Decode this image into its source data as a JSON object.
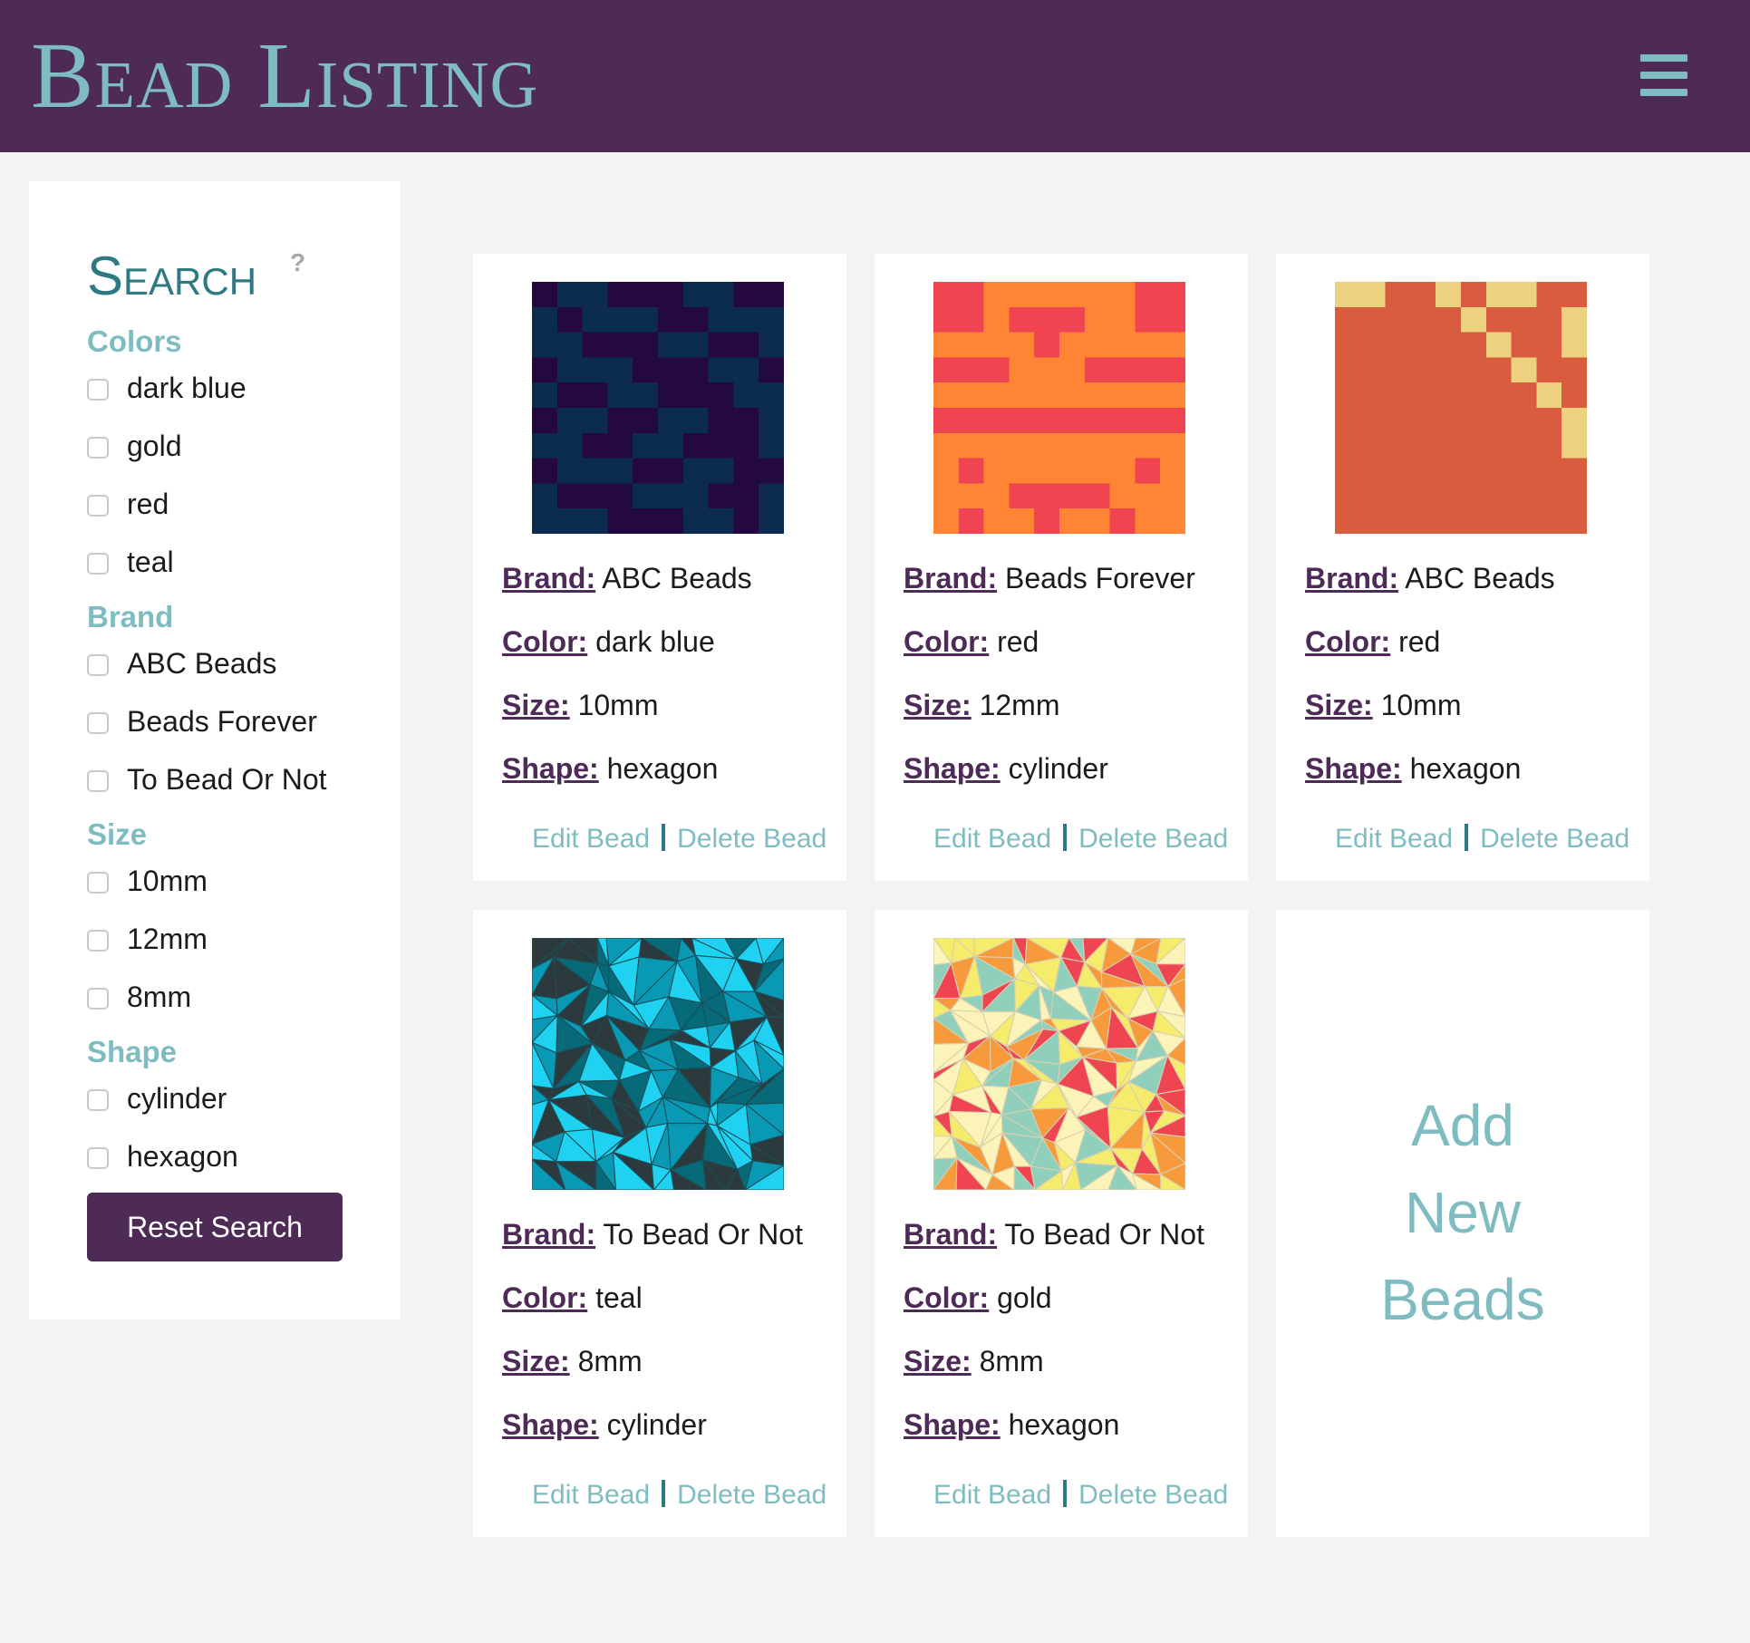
{
  "header": {
    "title": "Bead Listing",
    "menu_icon": "hamburger-menu-icon"
  },
  "search": {
    "title": "Search",
    "help": "?",
    "groups": [
      {
        "title": "Colors",
        "options": [
          "dark blue",
          "gold",
          "red",
          "teal"
        ]
      },
      {
        "title": "Brand",
        "options": [
          "ABC Beads",
          "Beads Forever",
          "To Bead Or Not"
        ]
      },
      {
        "title": "Size",
        "options": [
          "10mm",
          "12mm",
          "8mm"
        ]
      },
      {
        "title": "Shape",
        "options": [
          "cylinder",
          "hexagon"
        ]
      }
    ],
    "reset_label": "Reset Search"
  },
  "labels": {
    "brand": "Brand:",
    "color": "Color:",
    "size": "Size:",
    "shape": "Shape:",
    "edit": "Edit Bead",
    "delete": "Delete Bead"
  },
  "beads": [
    {
      "brand": "ABC Beads",
      "color": "dark blue",
      "size": "10mm",
      "shape": "hexagon",
      "palette": [
        "#0b2c4f",
        "#23093f"
      ]
    },
    {
      "brand": "Beads Forever",
      "color": "red",
      "size": "12mm",
      "shape": "cylinder",
      "palette": [
        "#f04452",
        "#ff8433"
      ]
    },
    {
      "brand": "ABC Beads",
      "color": "red",
      "size": "10mm",
      "shape": "hexagon",
      "palette": [
        "#d95c3f",
        "#ecd27e"
      ]
    },
    {
      "brand": "To Bead Or Not",
      "color": "teal",
      "size": "8mm",
      "shape": "cylinder",
      "palette": [
        "#0a99b5",
        "#1fd2f2",
        "#2c3a3e",
        "#066a79"
      ]
    },
    {
      "brand": "To Bead Or Not",
      "color": "gold",
      "size": "8mm",
      "shape": "hexagon",
      "palette": [
        "#ef4550",
        "#f79a3c",
        "#8fcfbc",
        "#f4ec6a",
        "#fcf3b8"
      ]
    }
  ],
  "add_card": {
    "lines": [
      "Add",
      "New",
      "Beads"
    ]
  },
  "colors": {
    "header_bg": "#4e2a57",
    "accent": "#7fbcc1",
    "dark_accent": "#2e7a82",
    "page_bg": "#f2f3f4"
  }
}
